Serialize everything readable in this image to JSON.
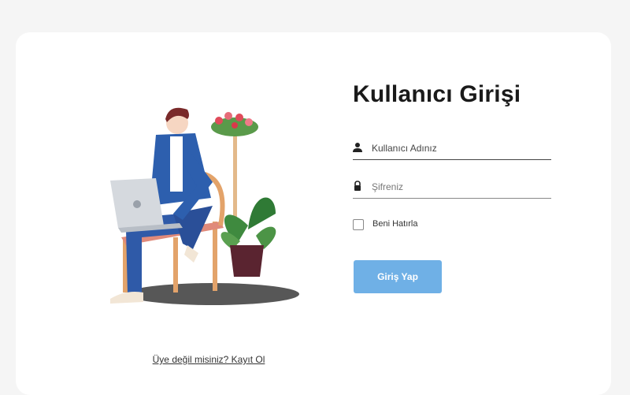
{
  "login": {
    "title": "Kullanıcı Girişi",
    "username_placeholder": "Kullanıcı Adınız",
    "password_placeholder": "Şifreniz",
    "remember_label": "Beni Hatırla",
    "submit_label": "Giriş Yap",
    "signup_link": "Üye değil misiniz? Kayıt Ol"
  },
  "colors": {
    "page_bg": "#f5f5f5",
    "card_bg": "#ffffff",
    "button_bg": "#6fb0e6",
    "title": "#1a1a1a"
  },
  "icons": {
    "username": "user-icon",
    "password": "lock-icon"
  }
}
